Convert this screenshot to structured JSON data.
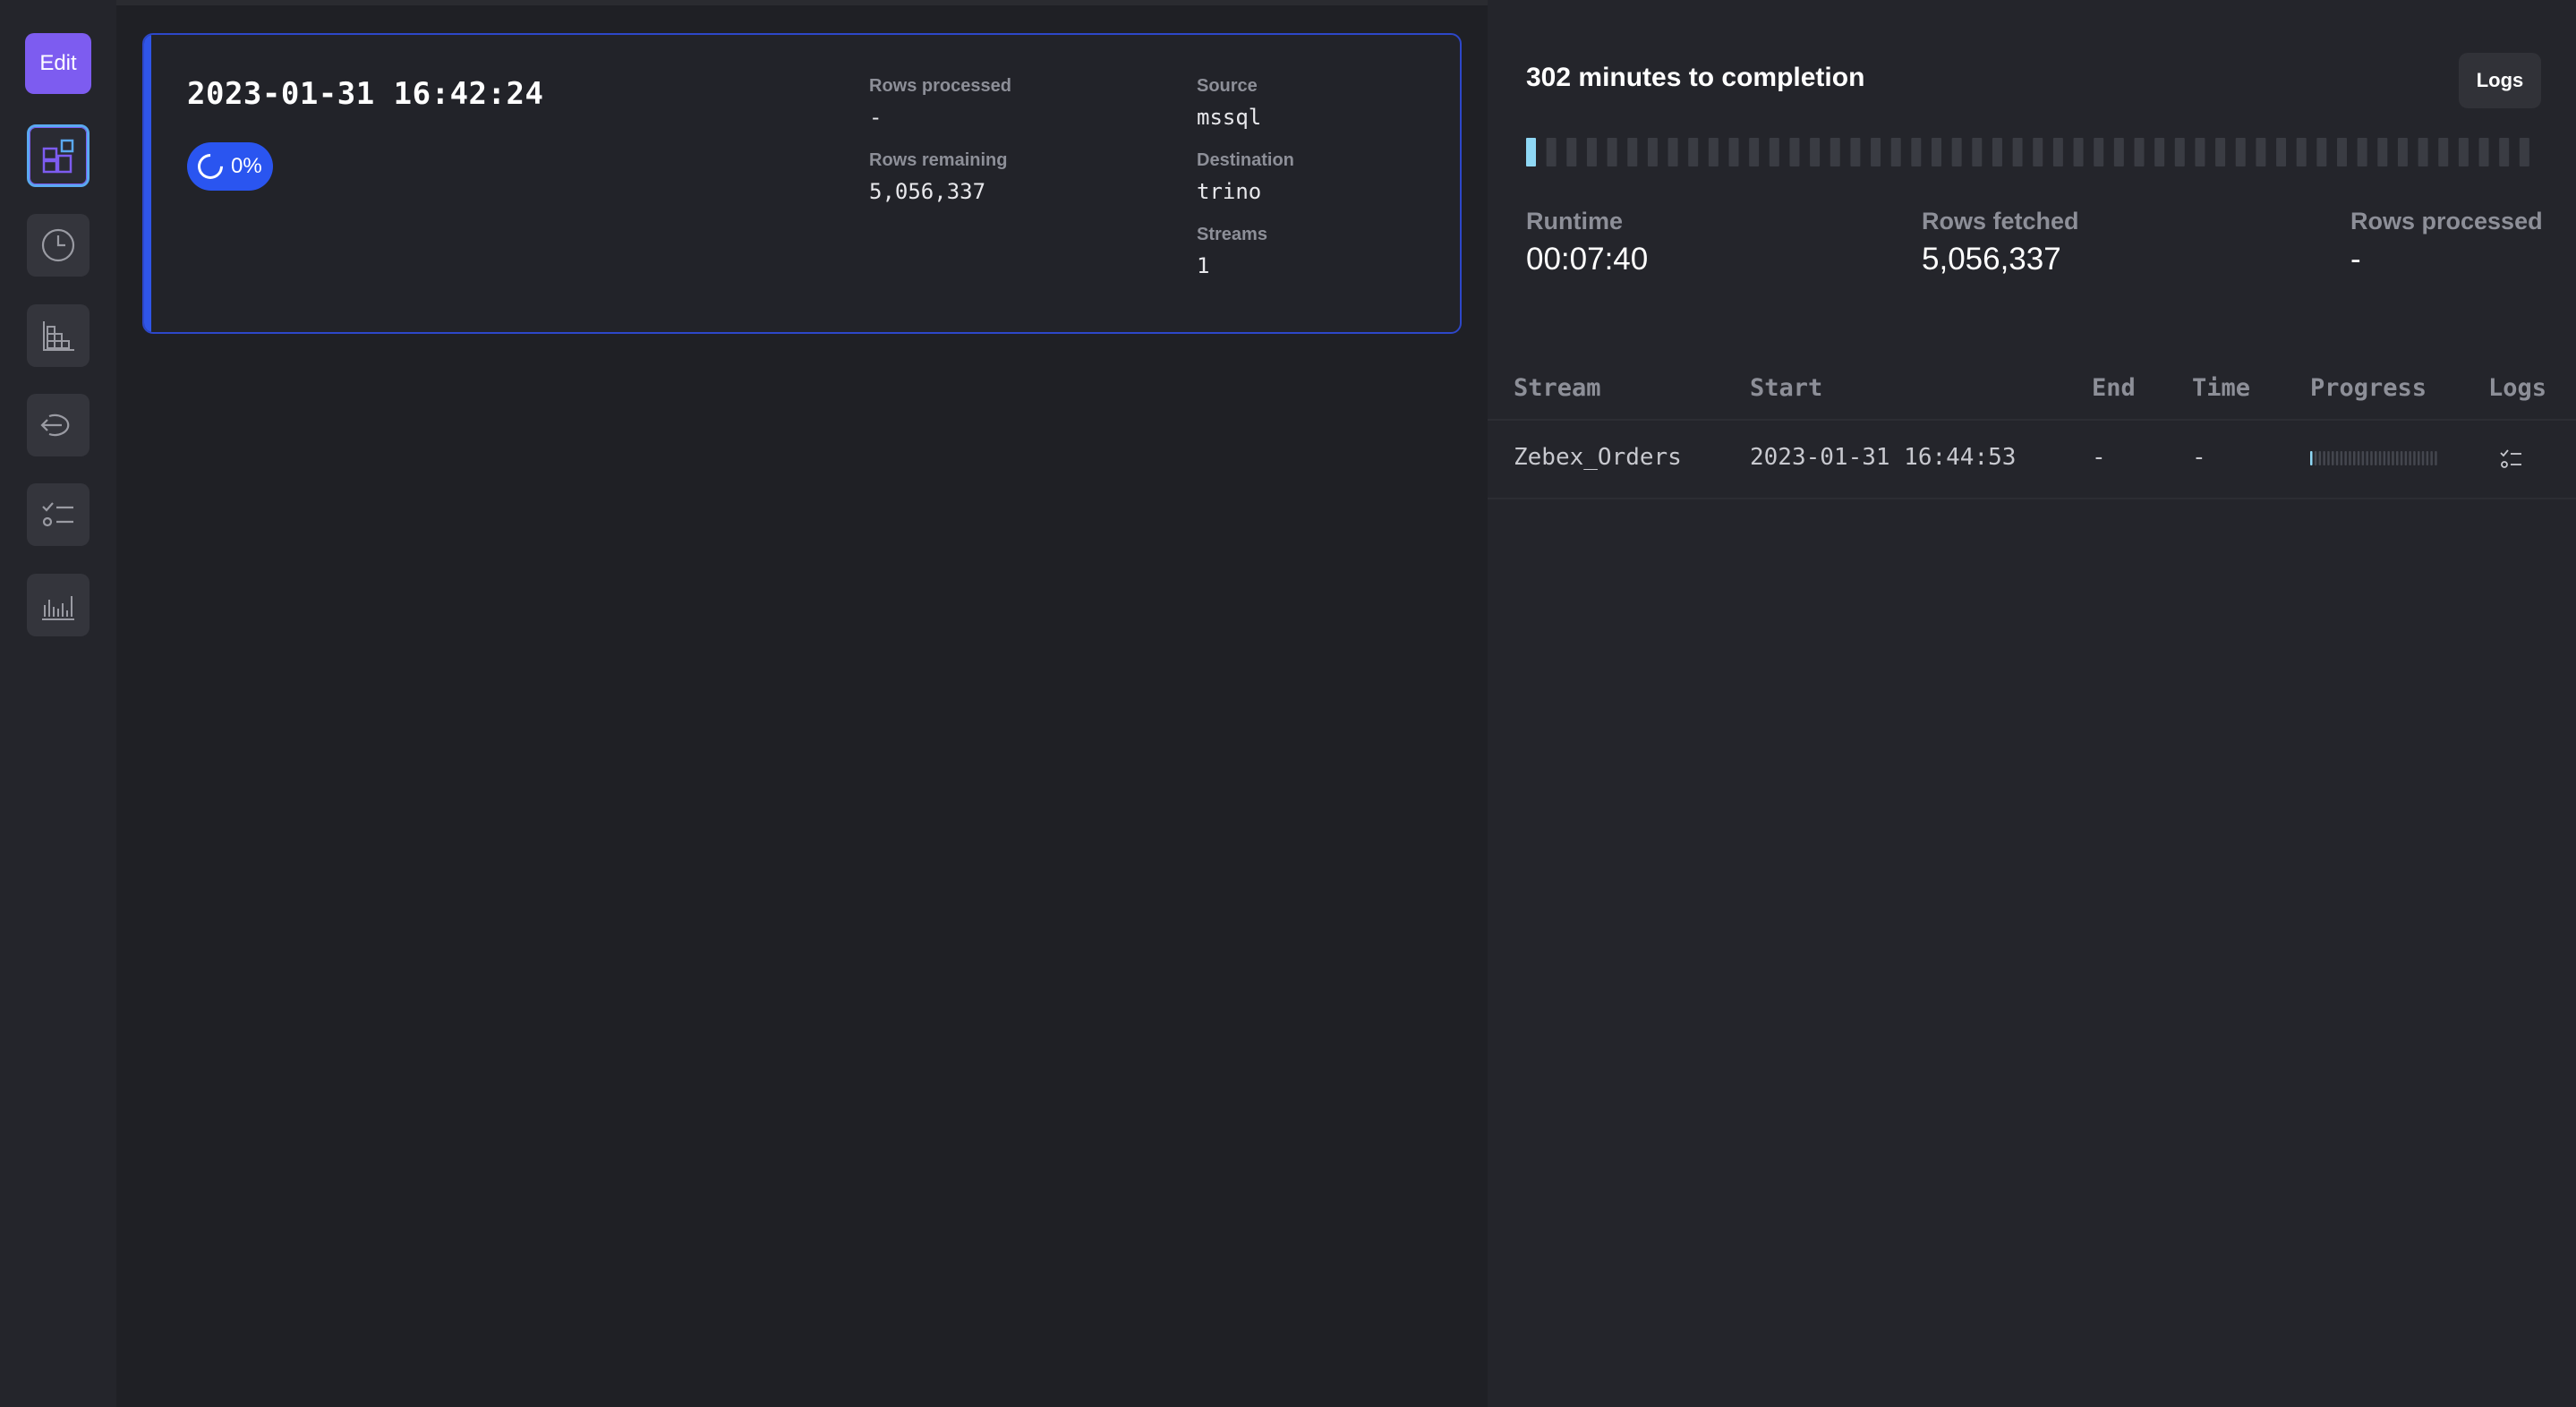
{
  "sidebar": {
    "edit_label": "Edit",
    "nav": [
      {
        "icon": "dashboard-icon",
        "active": true
      },
      {
        "icon": "clock-icon",
        "active": false
      },
      {
        "icon": "blocks-icon",
        "active": false
      },
      {
        "icon": "connection-icon",
        "active": false
      },
      {
        "icon": "checklist-icon",
        "active": false
      },
      {
        "icon": "bar-chart-icon",
        "active": false
      }
    ]
  },
  "run_card": {
    "title": "2023-01-31 16:42:24",
    "progress_label": "0%",
    "progress_color": "#2a55f0",
    "accent_color": "#2f55e8",
    "rows_processed_label": "Rows processed",
    "rows_processed_value": "-",
    "rows_remaining_label": "Rows remaining",
    "rows_remaining_value": "5,056,337",
    "source_label": "Source",
    "source_value": "mssql",
    "destination_label": "Destination",
    "destination_value": "trino",
    "streams_label": "Streams",
    "streams_value": "1"
  },
  "detail": {
    "completion_text": "302 minutes to completion",
    "logs_label": "Logs",
    "progress_fraction": 0.0,
    "progress_color": "#8fd8f5",
    "runtime_label": "Runtime",
    "runtime_value": "00:07:40",
    "rows_fetched_label": "Rows fetched",
    "rows_fetched_value": "5,056,337",
    "rows_processed_label": "Rows processed",
    "rows_processed_value": "-"
  },
  "streams_table": {
    "headers": [
      "Stream",
      "Start",
      "End",
      "Time",
      "Progress",
      "Logs"
    ],
    "rows": [
      {
        "stream": "Zebex_Orders",
        "start": "2023-01-31 16:44:53",
        "end": "-",
        "time": "-",
        "progress_fraction": 0.0
      }
    ]
  }
}
